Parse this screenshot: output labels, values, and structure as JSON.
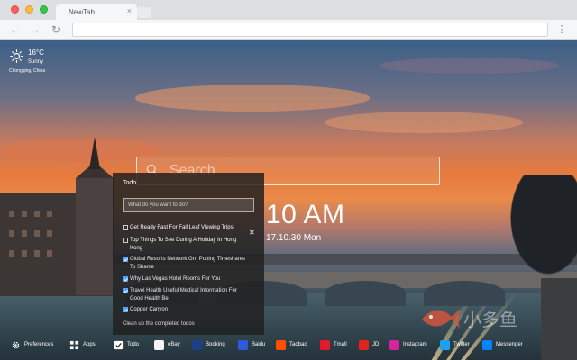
{
  "browser": {
    "tab_title": "NewTab",
    "tab_close": "×",
    "nav": {
      "back": "←",
      "forward": "→",
      "reload": "↻",
      "menu": "⋮"
    }
  },
  "weather": {
    "temperature": "16°C",
    "condition": "Sunny",
    "location": "Chongqing,   China",
    "icon": "sun-icon"
  },
  "search": {
    "placeholder": "Search"
  },
  "clock": {
    "time": "10 AM",
    "date": "17.10.30 Mon"
  },
  "todo": {
    "title": "Todo",
    "input_placeholder": "What do you want to do?",
    "delete_glyph": "✕",
    "items": [
      {
        "text": "Get Ready Fast For Fall Leaf Viewing Trips",
        "done": false
      },
      {
        "text": "Top Things To See During A Holiday In Hong Kong",
        "done": false
      },
      {
        "text": "Global Resorts Network Grn Putting Timeshares To Shame",
        "done": true
      },
      {
        "text": "Why Las Vegas Hotel Rooms For You",
        "done": true
      },
      {
        "text": "Travel Health Useful Medical Information For Good Health Be",
        "done": true
      },
      {
        "text": "Copper Canyon",
        "done": true
      }
    ],
    "clear_label": "Clean up the completed todos"
  },
  "bottom_bar": [
    {
      "label": "Preferences",
      "icon": "gear-icon",
      "color": "#ffffff"
    },
    {
      "label": "Apps",
      "icon": "grid-icon",
      "color": "#ffffff"
    },
    {
      "label": "Todo",
      "icon": "checkbox-icon",
      "color": "#ffffff"
    },
    {
      "label": "eBay",
      "icon": "ebay-icon",
      "color": "#f4f4f4"
    },
    {
      "label": "Booking",
      "icon": "booking-icon",
      "color": "#1b3f8b"
    },
    {
      "label": "Baidu",
      "icon": "baidu-icon",
      "color": "#2f5bd8"
    },
    {
      "label": "Taobao",
      "icon": "taobao-icon",
      "color": "#ff5000"
    },
    {
      "label": "Tmall",
      "icon": "tmall-icon",
      "color": "#e21a2c"
    },
    {
      "label": "JD",
      "icon": "jd-icon",
      "color": "#e1251b"
    },
    {
      "label": "Instagram",
      "icon": "instagram-icon",
      "color": "#d6249f"
    },
    {
      "label": "Twitter",
      "icon": "twitter-icon",
      "color": "#1da1f2"
    },
    {
      "label": "Messenger",
      "icon": "messenger-icon",
      "color": "#0084ff"
    }
  ],
  "watermark": {
    "text": "小多鱼"
  }
}
